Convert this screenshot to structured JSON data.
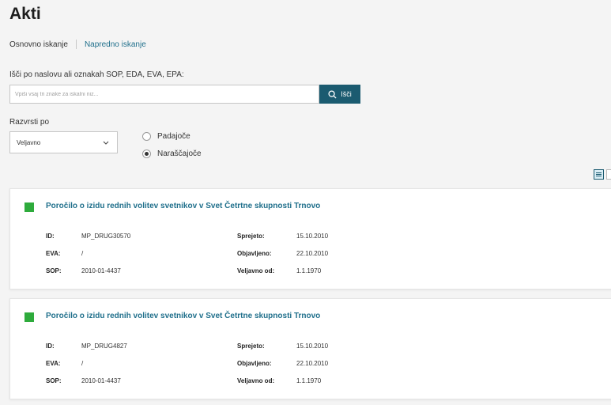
{
  "page": {
    "title": "Akti"
  },
  "tabs": {
    "basic": "Osnovno iskanje",
    "advanced": "Napredno iskanje"
  },
  "search": {
    "label": "Išči po naslovu ali oznakah SOP, EDA, EVA, EPA:",
    "placeholder": "Vpiši vsaj tri znake za iskalni niz...",
    "value": "",
    "button_label": "Išči"
  },
  "sort": {
    "label": "Razvrsti po",
    "selected": "Veljavno",
    "options": [
      {
        "label": "Padajoče",
        "checked": false
      },
      {
        "label": "Naraščajoče",
        "checked": true
      }
    ]
  },
  "view": {
    "active": "list"
  },
  "results": [
    {
      "title": "Poročilo o izidu rednih volitev svetnikov v Svet Četrtne skupnosti Trnovo",
      "status_color": "#2eab3c",
      "id_label": "ID:",
      "id": "MP_DRUG30570",
      "eva_label": "EVA:",
      "eva": "/",
      "sop_label": "SOP:",
      "sop": "2010-01-4437",
      "adopted_label": "Sprejeto:",
      "adopted": "15.10.2010",
      "published_label": "Objavljeno:",
      "published": "22.10.2010",
      "valid_label": "Veljavno od:",
      "valid_from": "1.1.1970"
    },
    {
      "title": "Poročilo o izidu rednih volitev svetnikov v Svet Četrtne skupnosti Trnovo",
      "status_color": "#2eab3c",
      "id_label": "ID:",
      "id": "MP_DRUG4827",
      "eva_label": "EVA:",
      "eva": "/",
      "sop_label": "SOP:",
      "sop": "2010-01-4437",
      "adopted_label": "Sprejeto:",
      "adopted": "15.10.2010",
      "published_label": "Objavljeno:",
      "published": "22.10.2010",
      "valid_label": "Veljavno od:",
      "valid_from": "1.1.1970"
    }
  ]
}
